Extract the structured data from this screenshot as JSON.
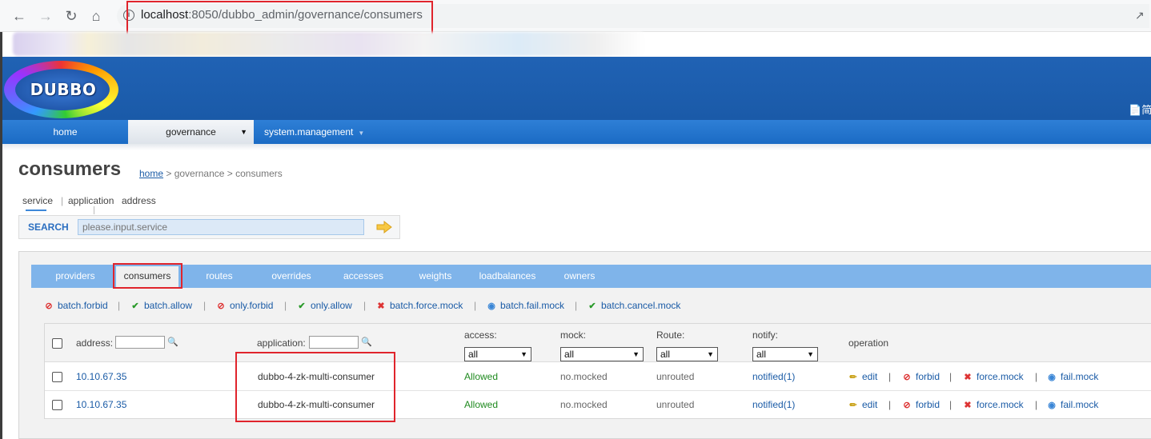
{
  "browser": {
    "url_host": "localhost",
    "url_rest": ":8050/dubbo_admin/governance/consumers"
  },
  "header": {
    "logo_text": "DUBBO",
    "lang_label": "简体"
  },
  "menu": {
    "home": "home",
    "governance": "governance",
    "system": "system.management"
  },
  "page": {
    "title": "consumers",
    "breadcrumb": {
      "home": "home",
      "trail": " > governance > consumers"
    }
  },
  "search": {
    "tabs": [
      "service",
      "application",
      "address"
    ],
    "label": "SEARCH",
    "placeholder": "please.input.service"
  },
  "tabs": [
    "providers",
    "consumers",
    "routes",
    "overrides",
    "accesses",
    "weights",
    "loadbalances",
    "owners"
  ],
  "actions": [
    "batch.forbid",
    "batch.allow",
    "only.forbid",
    "only.allow",
    "batch.force.mock",
    "batch.fail.mock",
    "batch.cancel.mock"
  ],
  "table": {
    "headers": {
      "address": "address:",
      "application": "application:",
      "access": "access:",
      "mock": "mock:",
      "route": "Route:",
      "notify": "notify:",
      "operation": "operation"
    },
    "filters": {
      "access": "all",
      "mock": "all",
      "route": "all",
      "notify": "all"
    },
    "rows": [
      {
        "address": "10.10.67.35",
        "application": "dubbo-4-zk-multi-consumer",
        "access": "Allowed",
        "mock": "no.mocked",
        "route": "unrouted",
        "notify": "notified(1)"
      },
      {
        "address": "10.10.67.35",
        "application": "dubbo-4-zk-multi-consumer",
        "access": "Allowed",
        "mock": "no.mocked",
        "route": "unrouted",
        "notify": "notified(1)"
      }
    ],
    "operations": [
      "edit",
      "forbid",
      "force.mock",
      "fail.mock"
    ]
  },
  "colors": {
    "header_blue": "#2062b4",
    "tab_blue": "#7fb4ea",
    "link": "#1a5ba6",
    "highlight_red": "#e0242c"
  }
}
